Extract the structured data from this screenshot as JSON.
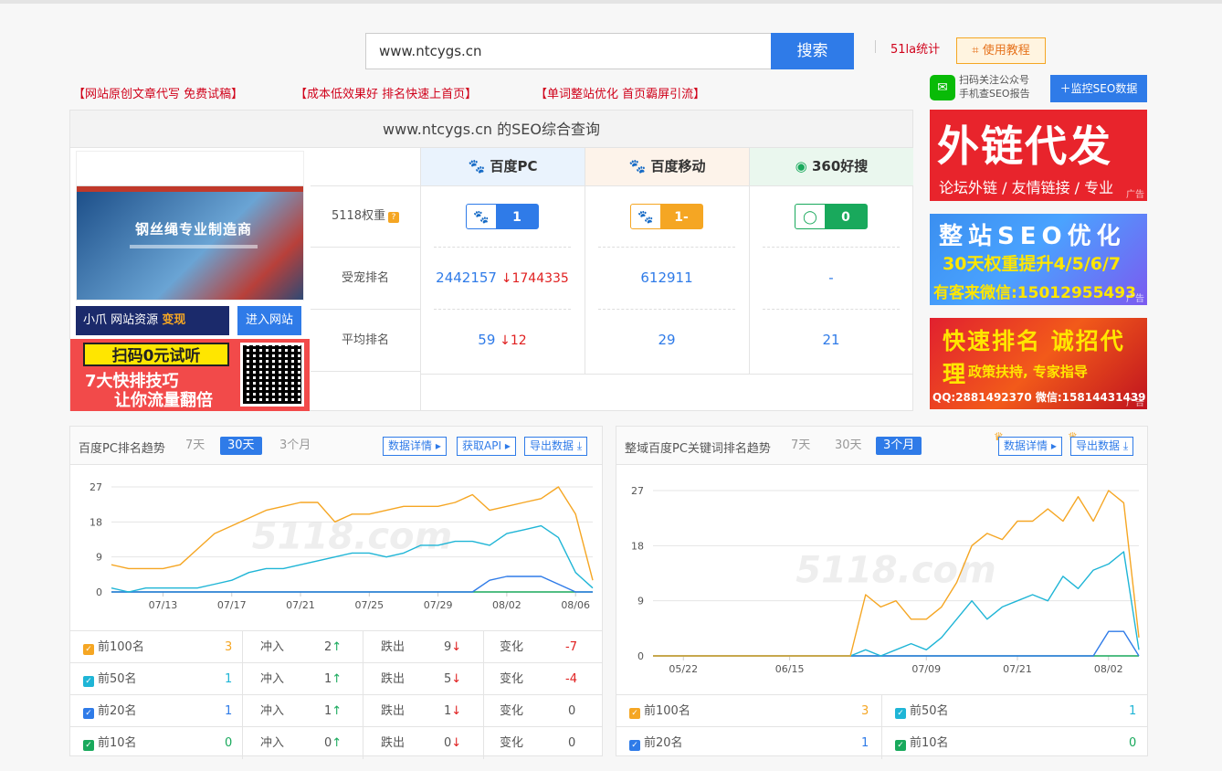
{
  "search": {
    "value": "www.ntcygs.cn",
    "button": "搜索"
  },
  "top_links": {
    "stat": "51la统计",
    "tutorial": "使用教程"
  },
  "ad_links": [
    "【网站原创文章代写 免费试稿】",
    "【成本低效果好 排名快速上首页】",
    "【单词整站优化 首页霸屏引流】"
  ],
  "wechat": {
    "line1": "扫码关注公众号",
    "line2": "手机查SEO报告",
    "monitor": "监控SEO数据"
  },
  "panel": {
    "title": "www.ntcygs.cn 的SEO综合查询",
    "screenshot_heading": "钢丝绳专业制造商",
    "xiaoz": {
      "brand": "小爪",
      "text": "网站资源",
      "highlight": "变现"
    },
    "enter_site": "进入网站",
    "qr_ad": {
      "line1": "扫码0元试听",
      "line2": "7大快排技巧",
      "line3": "让你流量翻倍"
    },
    "engines": [
      {
        "name": "百度PC",
        "weight": "1",
        "indexed": "2442157",
        "indexed_change": "1744335",
        "avg": "59",
        "avg_change": "12"
      },
      {
        "name": "百度移动",
        "weight": "1-",
        "indexed": "612911",
        "avg": "29"
      },
      {
        "name": "360好搜",
        "weight": "0",
        "indexed": "-",
        "avg": "21"
      }
    ],
    "rows": [
      "5118权重",
      "受宠排名",
      "平均排名"
    ],
    "weight_hint": "?"
  },
  "right_ads": {
    "ad1": {
      "a": "外链代发",
      "b": "论坛外链 / 友情链接 / 专业",
      "tag": "广告"
    },
    "ad2": {
      "a": "整站SEO优化",
      "b": "30天权重提升4/5/6/7",
      "c": "有客来微信:15012955493",
      "tag": "广告"
    },
    "ad3": {
      "a": "快速排名 诚招代理",
      "b": "政策扶持, 专家指导",
      "c": "QQ:2881492370 微信:15814431439",
      "tag": "广告"
    }
  },
  "left_chart_panel": {
    "title": "百度PC排名趋势",
    "tabs": [
      "7天",
      "30天",
      "3个月"
    ],
    "buttons": [
      "数据详情",
      "获取API",
      "导出数据"
    ],
    "watermark": "5118.com",
    "stats": [
      {
        "label": "前100名",
        "value": "3",
        "in_label": "冲入",
        "in": "2",
        "out_label": "跌出",
        "out": "9",
        "chg_label": "变化",
        "chg": "-7",
        "color": "#f5a623"
      },
      {
        "label": "前50名",
        "value": "1",
        "in_label": "冲入",
        "in": "1",
        "out_label": "跌出",
        "out": "5",
        "chg_label": "变化",
        "chg": "-4",
        "color": "#1fb5d6"
      },
      {
        "label": "前20名",
        "value": "1",
        "in_label": "冲入",
        "in": "1",
        "out_label": "跌出",
        "out": "1",
        "chg_label": "变化",
        "chg": "0",
        "color": "#2f7be8"
      },
      {
        "label": "前10名",
        "value": "0",
        "in_label": "冲入",
        "in": "0",
        "out_label": "跌出",
        "out": "0",
        "chg_label": "变化",
        "chg": "0",
        "color": "#19a95c"
      }
    ]
  },
  "right_chart_panel": {
    "title": "整域百度PC关键词排名趋势",
    "tabs": [
      "7天",
      "30天",
      "3个月"
    ],
    "buttons": [
      "数据详情",
      "导出数据"
    ],
    "watermark": "5118.com",
    "stats": [
      {
        "label": "前100名",
        "value": "3",
        "color": "#f5a623"
      },
      {
        "label": "前50名",
        "value": "1",
        "color": "#1fb5d6"
      },
      {
        "label": "前20名",
        "value": "1",
        "color": "#2f7be8"
      },
      {
        "label": "前10名",
        "value": "0",
        "color": "#19a95c"
      }
    ]
  },
  "chart_data": [
    {
      "type": "line",
      "title": "百度PC排名趋势",
      "x": [
        "07/10",
        "07/11",
        "07/12",
        "07/13",
        "07/14",
        "07/15",
        "07/16",
        "07/17",
        "07/18",
        "07/19",
        "07/20",
        "07/21",
        "07/22",
        "07/23",
        "07/24",
        "07/25",
        "07/26",
        "07/27",
        "07/28",
        "07/29",
        "07/30",
        "07/31",
        "08/01",
        "08/02",
        "08/03",
        "08/04",
        "08/05",
        "08/06",
        "08/07"
      ],
      "xticks": [
        "07/13",
        "07/17",
        "07/21",
        "07/25",
        "07/29",
        "08/02",
        "08/06"
      ],
      "ylim": [
        0,
        27
      ],
      "yticks": [
        0,
        9,
        18,
        27
      ],
      "series": [
        {
          "values": [
            7,
            6,
            6,
            6,
            7,
            11,
            15,
            17,
            19,
            21,
            22,
            23,
            23,
            18,
            20,
            20,
            21,
            22,
            22,
            22,
            23,
            25,
            21,
            22,
            23,
            24,
            27,
            20,
            3
          ],
          "color": "#f5a623"
        },
        {
          "values": [
            1,
            0,
            1,
            1,
            1,
            1,
            2,
            3,
            5,
            6,
            6,
            7,
            8,
            9,
            10,
            10,
            9,
            10,
            12,
            12,
            13,
            13,
            12,
            15,
            16,
            17,
            14,
            5,
            1
          ],
          "color": "#1fb5d6"
        },
        {
          "values": [
            0,
            0,
            0,
            0,
            0,
            0,
            0,
            0,
            0,
            0,
            0,
            0,
            0,
            0,
            0,
            0,
            0,
            0,
            0,
            0,
            0,
            0,
            3,
            4,
            4,
            4,
            2,
            0,
            0
          ],
          "color": "#2f7be8"
        },
        {
          "values": [
            0,
            0,
            0,
            0,
            0,
            0,
            0,
            0,
            0,
            0,
            0,
            0,
            0,
            0,
            0,
            0,
            0,
            0,
            0,
            0,
            0,
            0,
            0,
            0,
            0,
            0,
            0,
            0,
            0
          ],
          "color": "#19a95c"
        }
      ]
    },
    {
      "type": "line",
      "title": "整域百度PC关键词排名趋势",
      "x": [
        "05/15",
        "05/18",
        "05/22",
        "05/25",
        "05/29",
        "06/01",
        "06/05",
        "06/08",
        "06/12",
        "06/15",
        "06/19",
        "06/22",
        "06/26",
        "06/29",
        "07/01",
        "07/03",
        "07/05",
        "07/07",
        "07/09",
        "07/11",
        "07/13",
        "07/15",
        "07/17",
        "07/19",
        "07/21",
        "07/23",
        "07/25",
        "07/27",
        "07/29",
        "07/31",
        "08/02",
        "08/04",
        "08/06"
      ],
      "xticks": [
        "05/22",
        "06/03",
        "06/15",
        "06/27",
        "07/09",
        "07/21",
        "08/02"
      ],
      "ylim": [
        0,
        27
      ],
      "yticks": [
        0,
        9,
        18,
        27
      ],
      "series": [
        {
          "values": [
            0,
            0,
            0,
            0,
            0,
            0,
            0,
            0,
            0,
            0,
            0,
            0,
            0,
            0,
            10,
            8,
            9,
            6,
            6,
            8,
            12,
            18,
            20,
            19,
            22,
            22,
            24,
            22,
            26,
            22,
            27,
            25,
            3
          ],
          "color": "#f5a623"
        },
        {
          "values": [
            0,
            0,
            0,
            0,
            0,
            0,
            0,
            0,
            0,
            0,
            0,
            0,
            0,
            0,
            1,
            0,
            1,
            2,
            1,
            3,
            6,
            9,
            6,
            8,
            9,
            10,
            9,
            13,
            11,
            14,
            15,
            17,
            1
          ],
          "color": "#1fb5d6"
        },
        {
          "values": [
            0,
            0,
            0,
            0,
            0,
            0,
            0,
            0,
            0,
            0,
            0,
            0,
            0,
            0,
            0,
            0,
            0,
            0,
            0,
            0,
            0,
            0,
            0,
            0,
            0,
            0,
            0,
            0,
            0,
            0,
            4,
            4,
            0
          ],
          "color": "#2f7be8"
        },
        {
          "values": [
            0,
            0,
            0,
            0,
            0,
            0,
            0,
            0,
            0,
            0,
            0,
            0,
            0,
            0,
            0,
            0,
            0,
            0,
            0,
            0,
            0,
            0,
            0,
            0,
            0,
            0,
            0,
            0,
            0,
            0,
            0,
            0,
            0
          ],
          "color": "#19a95c"
        }
      ]
    }
  ]
}
